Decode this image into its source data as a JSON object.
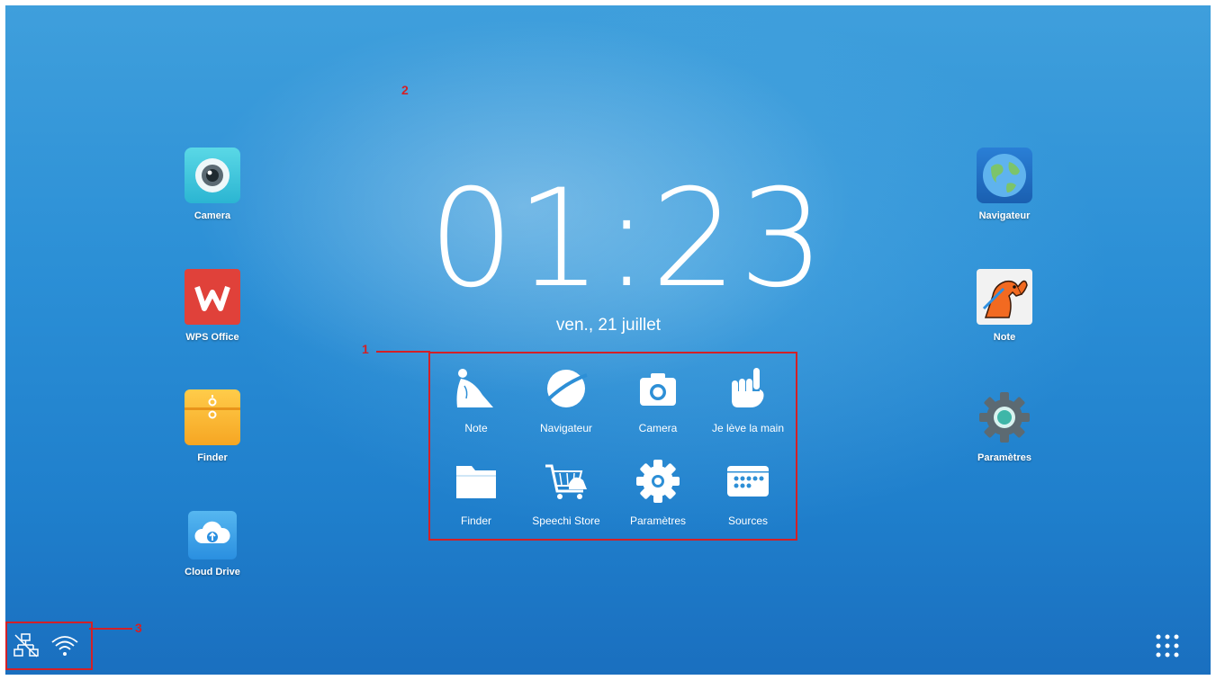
{
  "desktop": {
    "left_apps": [
      {
        "label": "Camera",
        "icon": "camera-app-icon"
      },
      {
        "label": "WPS Office",
        "icon": "wps-office-icon"
      },
      {
        "label": "Finder",
        "icon": "finder-folder-icon"
      },
      {
        "label": "Cloud Drive",
        "icon": "cloud-drive-icon"
      }
    ],
    "right_apps": [
      {
        "label": "Navigateur",
        "icon": "globe-browser-icon"
      },
      {
        "label": "Note",
        "icon": "dog-note-icon"
      },
      {
        "label": "Paramètres",
        "icon": "settings-gear-icon"
      }
    ]
  },
  "clock": {
    "time": "01:23",
    "date": "ven., 21 juillet"
  },
  "quick_panel": {
    "items": [
      {
        "label": "Note",
        "icon": "note-pen-icon"
      },
      {
        "label": "Navigateur",
        "icon": "planet-icon"
      },
      {
        "label": "Camera",
        "icon": "camera-icon"
      },
      {
        "label": "Je lève la main",
        "icon": "raise-hand-icon"
      },
      {
        "label": "Finder",
        "icon": "folder-icon"
      },
      {
        "label": "Speechi Store",
        "icon": "store-cart-icon"
      },
      {
        "label": "Paramètres",
        "icon": "gear-icon"
      },
      {
        "label": "Sources",
        "icon": "sources-icon"
      }
    ]
  },
  "annotations": {
    "marker1": "1",
    "marker2": "2",
    "marker3": "3",
    "color": "#d32026"
  },
  "status_bar": {
    "icons": [
      "network-disconnected-icon",
      "wifi-icon"
    ]
  },
  "app_drawer": {
    "icon": "app-grid-icon"
  }
}
